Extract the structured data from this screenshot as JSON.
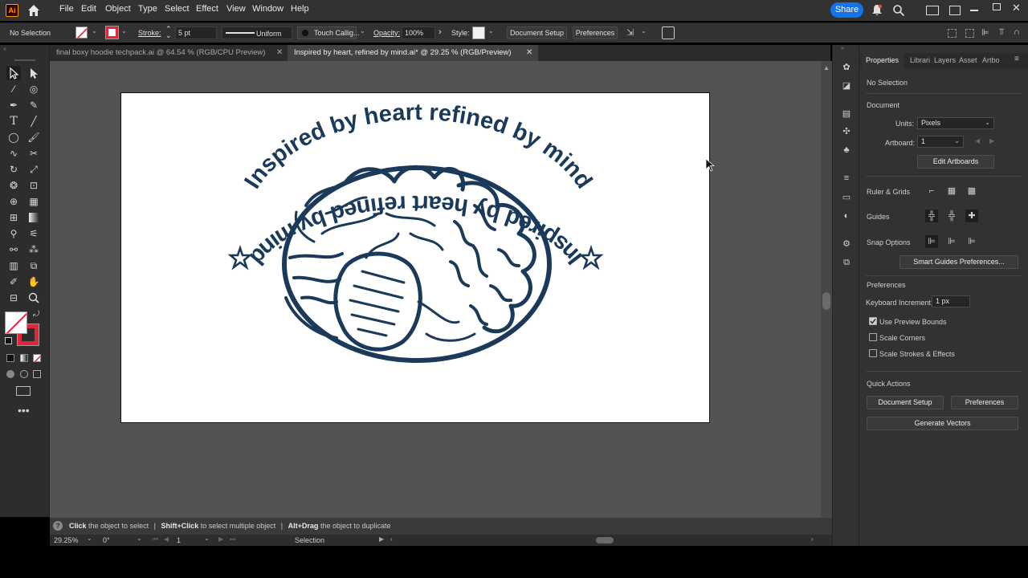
{
  "app": {
    "logo": "Ai"
  },
  "menu": {
    "items": [
      "File",
      "Edit",
      "Object",
      "Type",
      "Select",
      "Effect",
      "View",
      "Window",
      "Help"
    ],
    "share": "Share"
  },
  "control": {
    "selection": "No Selection",
    "stroke_label": "Stroke:",
    "stroke_value": "5 pt",
    "profile": "Uniform",
    "brush": "Touch Callig...",
    "opacity_label": "Opacity:",
    "opacity_value": "100%",
    "style_label": "Style:",
    "document_setup": "Document Setup",
    "preferences": "Preferences"
  },
  "tabs": [
    {
      "label": "final boxy hoodie techpack.ai @ 64.54 % (RGB/CPU Preview)",
      "active": false
    },
    {
      "label": "Inspired by heart, refined by mind.ai* @ 29.25 % (RGB/Preview)",
      "active": true
    }
  ],
  "artwork": {
    "text_top": "Inspired by heart refined by mind",
    "text_bottom": "Inspired by heart refined by mind",
    "ink_color": "#1b3a5a"
  },
  "status": {
    "click": "Click",
    "click_desc": "the object to select",
    "shift_click": "Shift+Click",
    "shift_desc": "to select multiple object",
    "alt_drag": "Alt+Drag",
    "alt_desc": "the object to duplicate",
    "zoom": "29.25%",
    "rotation": "0°",
    "artboard": "1",
    "tool": "Selection"
  },
  "properties": {
    "tabs": [
      "Properties",
      "Librari",
      "Layers",
      "Asset",
      "Artbo"
    ],
    "no_selection": "No Selection",
    "document_header": "Document",
    "units_label": "Units:",
    "units_value": "Pixels",
    "artboard_label": "Artboard:",
    "artboard_value": "1",
    "edit_artboards": "Edit Artboards",
    "ruler_grids": "Ruler & Grids",
    "guides": "Guides",
    "snap_options": "Snap Options",
    "smart_guides": "Smart Guides Preferences...",
    "preferences_header": "Preferences",
    "keyboard_increment_label": "Keyboard Increment:",
    "keyboard_increment_value": "1 px",
    "use_preview_bounds": "Use Preview Bounds",
    "scale_corners": "Scale Corners",
    "scale_strokes": "Scale Strokes & Effects",
    "quick_actions": "Quick Actions",
    "qa_document_setup": "Document Setup",
    "qa_preferences": "Preferences",
    "generate_vectors": "Generate Vectors"
  },
  "colors": {
    "accent": "#1473e6",
    "stroke_red": "#e0263a"
  }
}
